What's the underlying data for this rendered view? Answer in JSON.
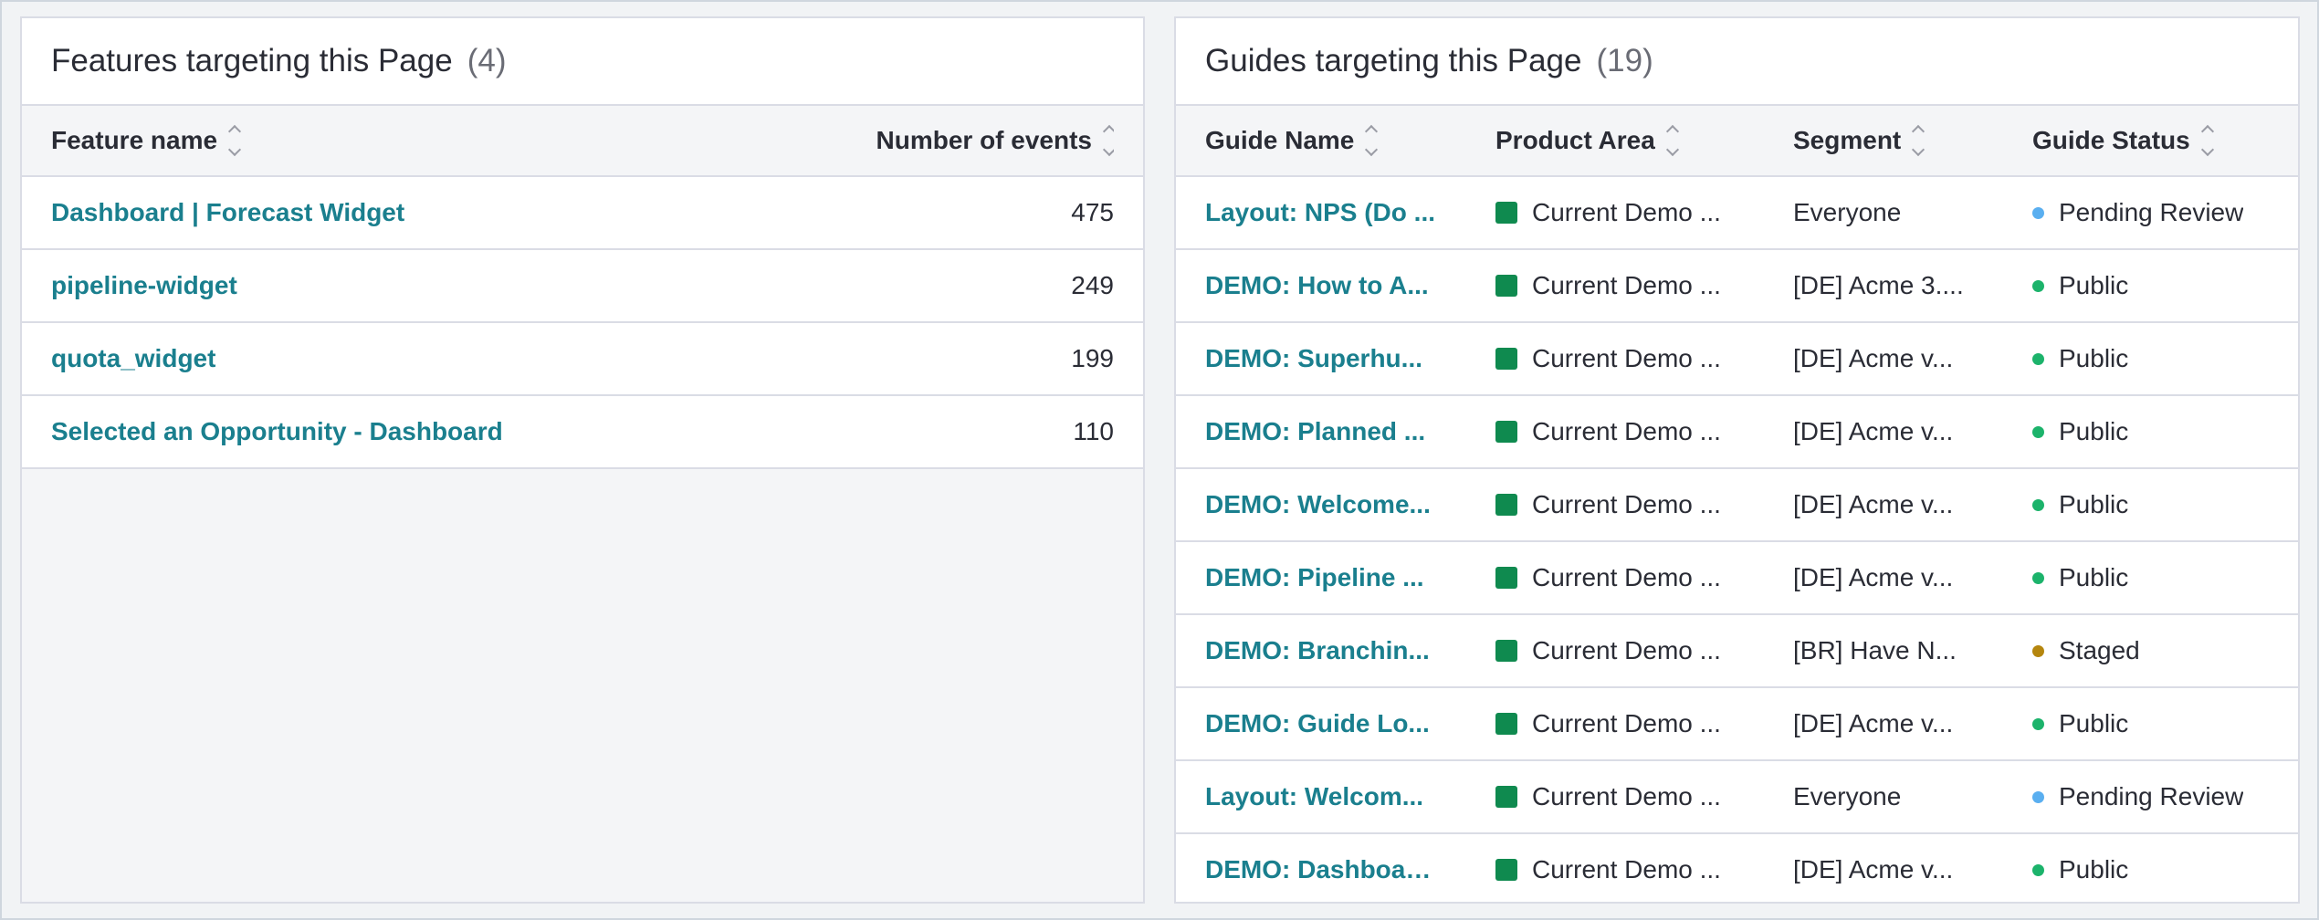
{
  "features": {
    "title": "Features targeting this Page",
    "count": "(4)",
    "columns": {
      "name": "Feature name",
      "events": "Number of events"
    },
    "rows": [
      {
        "name": "Dashboard | Forecast Widget",
        "events": "475"
      },
      {
        "name": "pipeline-widget",
        "events": "249"
      },
      {
        "name": "quota_widget",
        "events": "199"
      },
      {
        "name": "Selected an Opportunity - Dashboard",
        "events": "110"
      }
    ]
  },
  "guides": {
    "title": "Guides targeting this Page",
    "count": "(19)",
    "columns": {
      "name": "Guide Name",
      "area": "Product Area",
      "segment": "Segment",
      "status": "Guide Status"
    },
    "rows": [
      {
        "name": "Layout: NPS (Do ...",
        "area": "Current Demo ...",
        "segment": "Everyone",
        "status": "Pending Review"
      },
      {
        "name": "DEMO: How to A...",
        "area": "Current Demo ...",
        "segment": "[DE] Acme 3....",
        "status": "Public"
      },
      {
        "name": "DEMO: Superhu...",
        "area": "Current Demo ...",
        "segment": "[DE] Acme v...",
        "status": "Public"
      },
      {
        "name": "DEMO: Planned ...",
        "area": "Current Demo ...",
        "segment": "[DE] Acme v...",
        "status": "Public"
      },
      {
        "name": "DEMO: Welcome...",
        "area": "Current Demo ...",
        "segment": "[DE] Acme v...",
        "status": "Public"
      },
      {
        "name": "DEMO: Pipeline ...",
        "area": "Current Demo ...",
        "segment": "[DE] Acme v...",
        "status": "Public"
      },
      {
        "name": "DEMO: Branchin...",
        "area": "Current Demo ...",
        "segment": "[BR] Have N...",
        "status": "Staged"
      },
      {
        "name": "DEMO: Guide Lo...",
        "area": "Current Demo ...",
        "segment": "[DE] Acme v...",
        "status": "Public"
      },
      {
        "name": "Layout: Welcom...",
        "area": "Current Demo ...",
        "segment": "Everyone",
        "status": "Pending Review"
      },
      {
        "name": "DEMO: Dashboar...",
        "area": "Current Demo ...",
        "segment": "[DE] Acme v...",
        "status": "Public"
      }
    ]
  },
  "colors": {
    "link": "#1a7f8e",
    "product_area": "#0f8a4f",
    "status": {
      "Pending Review": "#5aaff0",
      "Public": "#1cb36b",
      "Staged": "#b5860e"
    }
  },
  "icons": {
    "sort": "sort-chevrons-icon"
  }
}
